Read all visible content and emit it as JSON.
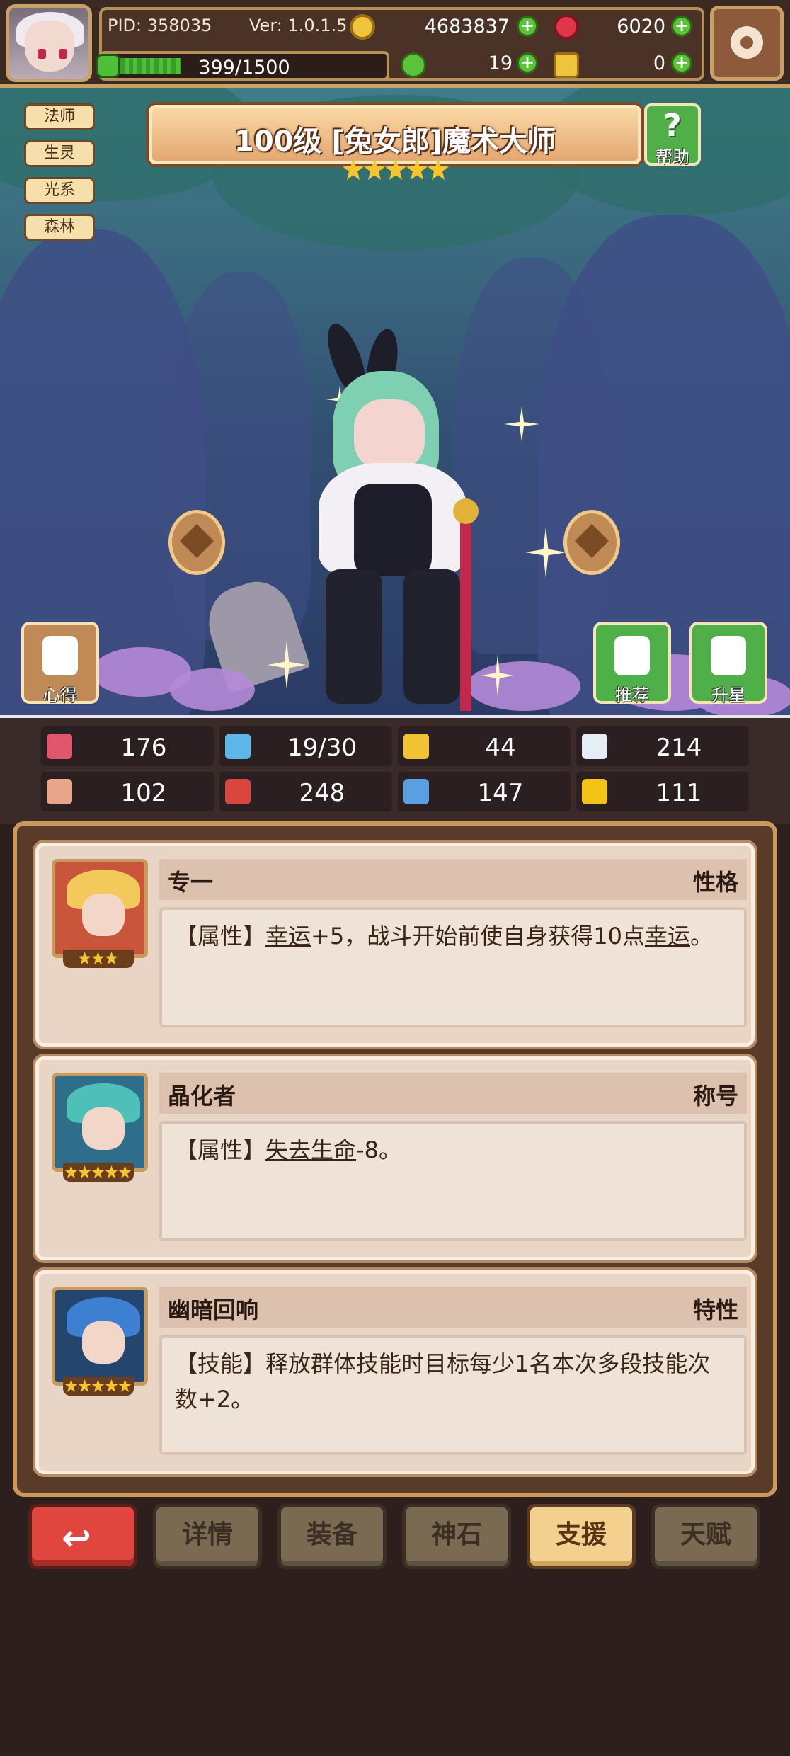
{
  "header": {
    "pid": "PID: 358035",
    "version": "Ver: 1.0.1.5",
    "gold": "4683837",
    "gems": "6020",
    "clover": "19",
    "keys": "0",
    "exp": "399/1500",
    "exp_fraction": 0.266
  },
  "hero": {
    "title": "100级 [兔女郎]魔术大师",
    "stars": 5,
    "tags": [
      "法师",
      "生灵",
      "光系",
      "森林"
    ],
    "help_label": "帮助",
    "left_button_label": "心得",
    "recommend_label": "推荐",
    "upgrade_label": "升星"
  },
  "stats": [
    {
      "icon": "heart-icon",
      "value": "176",
      "color": "#e0566a"
    },
    {
      "icon": "water-drop-icon",
      "value": "19/30",
      "color": "#5fb6e8"
    },
    {
      "icon": "shield-icon",
      "value": "44",
      "color": "#f1c232"
    },
    {
      "icon": "wing-icon",
      "value": "214",
      "color": "#e6eef5"
    },
    {
      "icon": "fist-icon",
      "value": "102",
      "color": "#e7a58a"
    },
    {
      "icon": "book-icon",
      "value": "248",
      "color": "#d9463f"
    },
    {
      "icon": "boot-icon",
      "value": "147",
      "color": "#5aa0e0"
    },
    {
      "icon": "horseshoe-icon",
      "value": "111",
      "color": "#f2c418"
    }
  ],
  "traits": [
    {
      "name": "专一",
      "type": "性格",
      "prefix": "【属性】",
      "u1": "幸运",
      "mid": "+5，战斗开始前使自身获得10点",
      "u2": "幸运",
      "suffix": "。",
      "stars": 3,
      "hair": "#f3c95c",
      "bg": "#c9553a"
    },
    {
      "name": "晶化者",
      "type": "称号",
      "prefix": "【属性】",
      "u1": "失去生命",
      "mid": "-8。",
      "u2": "",
      "suffix": "",
      "stars": 5,
      "hair": "#4fc0b8",
      "bg": "#2f6e8a"
    },
    {
      "name": "幽暗回响",
      "type": "特性",
      "prefix": "【技能】",
      "u1": "",
      "mid": "释放群体技能时目标每少1名本次多段技能次数+2。",
      "u2": "",
      "suffix": "",
      "stars": 5,
      "hair": "#3d7fd0",
      "bg": "#24466e"
    }
  ],
  "nav": {
    "back_icon": "back-arrow-icon",
    "items": [
      "详情",
      "装备",
      "神石",
      "支援",
      "天赋"
    ],
    "active": "支援"
  },
  "colors": {
    "accent_gold": "#c9a066",
    "back_red": "#e0463e",
    "active_tab": "#f3d08e"
  }
}
